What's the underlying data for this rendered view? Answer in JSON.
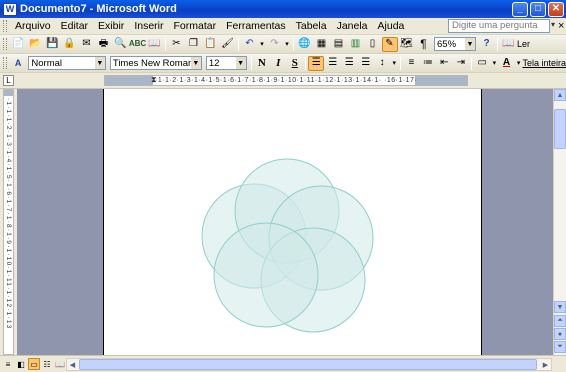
{
  "window": {
    "title": "Documento7 - Microsoft Word",
    "app_icon": "W",
    "controls": {
      "minimize": "_",
      "maximize": "□",
      "close": "✕"
    }
  },
  "menu": {
    "items": [
      "Arquivo",
      "Editar",
      "Exibir",
      "Inserir",
      "Formatar",
      "Ferramentas",
      "Tabela",
      "Janela",
      "Ajuda"
    ],
    "help_placeholder": "Digite uma pergunta",
    "doc_close": "×"
  },
  "standard_toolbar": {
    "icons": [
      "new-document-icon",
      "open-icon",
      "save-icon",
      "permission-icon",
      "email-icon",
      "print-icon",
      "print-preview-icon",
      "spelling-icon",
      "research-icon",
      "cut-icon",
      "copy-icon",
      "paste-icon",
      "format-painter-icon",
      "undo-icon",
      "redo-icon",
      "hyperlink-icon",
      "tables-borders-icon",
      "insert-table-icon",
      "insert-excel-icon",
      "columns-icon",
      "drawing-icon",
      "document-map-icon",
      "show-hide-icon"
    ],
    "zoom": "65%",
    "help_icon": "?",
    "read_label": "Ler"
  },
  "format_toolbar": {
    "style": "Normal",
    "font": "Times New Roman",
    "size": "12",
    "bold": "N",
    "italic": "I",
    "underline": "S",
    "fullscreen_label": "Tela inteira"
  },
  "ruler": {
    "h_numbers": "·1·1·2·1·3·1·4·1·5·1·6·1·7·1·8·1·9·1·10·1·11·1·12·1·13·1·14·1· ·16·1·17·",
    "v_numbers": "·1·1·1·2·1·3·1·4·1·5·1·6·1·7·1·8·1·9·1·10·1·11·1·12·1·13"
  },
  "colors": {
    "titlebar": "#0a4fd6",
    "workspace": "#8e95ad",
    "circle_stroke": "#8fcfcc",
    "circle_fill": "#cfe9e8"
  },
  "view_buttons": [
    "normal-view",
    "web-layout-view",
    "print-layout-view",
    "outline-view",
    "reading-view"
  ]
}
